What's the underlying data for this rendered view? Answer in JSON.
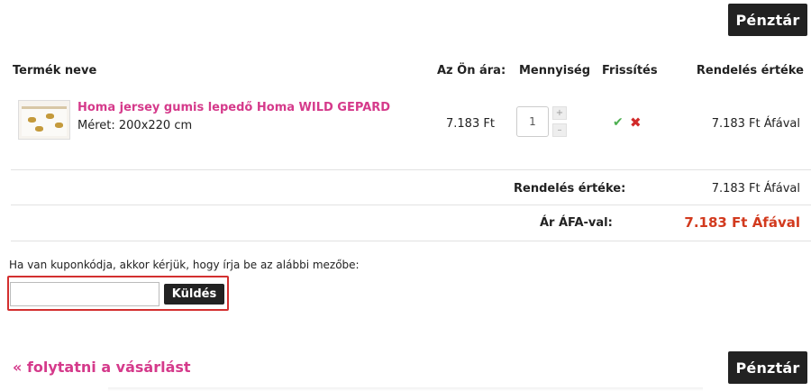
{
  "checkout_button_top": "Pénztár",
  "checkout_button_bottom": "Pénztár",
  "table": {
    "headers": {
      "name": "Termék neve",
      "price": "Az Ön ára:",
      "quantity": "Mennyiség",
      "refresh": "Frissítés",
      "total": "Rendelés értéke"
    },
    "rows": [
      {
        "name": "Homa jersey gumis lepedő Homa WILD GEPARD",
        "size": "Méret: 200x220 cm",
        "unit_price": "7.183 Ft",
        "quantity": "1",
        "stepper_plus": "+",
        "stepper_minus": "–",
        "confirm_icon": "✔",
        "remove_icon": "✖",
        "total": "7.183 Ft Áfával"
      }
    ]
  },
  "summary": {
    "subtotal_label": "Rendelés értéke:",
    "subtotal_value": "7.183 Ft Áfával",
    "grand_label": "Ár ÁFA-val:",
    "grand_value": "7.183 Ft Áfával"
  },
  "coupon": {
    "prompt": "Ha van kuponkódja, akkor kérjük, hogy írja be az alábbi mezőbe:",
    "input_value": "",
    "submit_label": "Küldés"
  },
  "continue_link": "« folytatni a vásárlást",
  "colors": {
    "accent_pink": "#d53a8b",
    "price_red": "#d23a1e",
    "highlight_border": "#d32f2f",
    "dark_button": "#222222",
    "check_green": "#4caf50",
    "remove_red": "#d12b2b"
  }
}
